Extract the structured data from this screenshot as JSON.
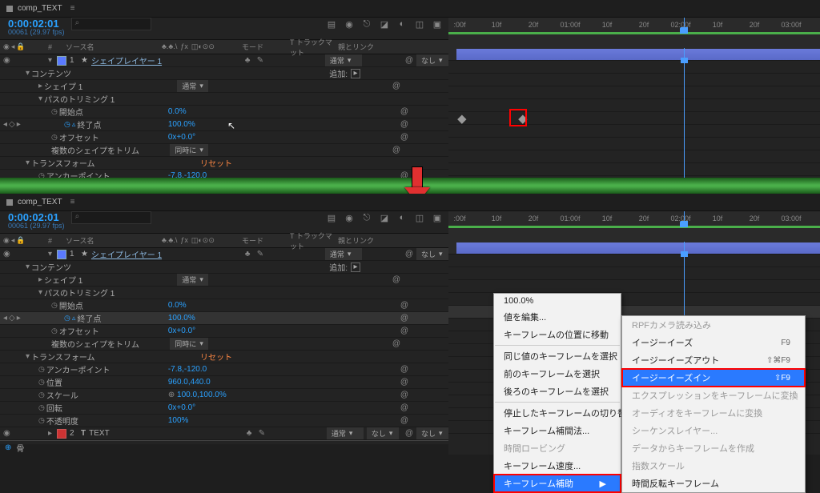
{
  "comp_tab": "comp_TEXT",
  "timecode": "0:00:02:01",
  "frameinfo": "00061 (29.97 fps)",
  "columns": {
    "num": "#",
    "source": "ソース名",
    "mode": "モード",
    "trackmatte": "T トラックマット",
    "parent": "親とリンク"
  },
  "layer1": {
    "idx": "1",
    "name": "シェイプレイヤー 1",
    "mode": "通常",
    "track_none": "なし",
    "contents": "コンテンツ",
    "add_label": "追加:",
    "shape1": "シェイプ 1",
    "shape1_mode": "通常",
    "trim_paths": "パスのトリミング 1",
    "start": "開始点",
    "start_val": "0.0%",
    "end": "終了点",
    "end_val": "100.0%",
    "end_val2": "100.0%",
    "offset": "オフセット",
    "offset_val": "0x+0.0°",
    "trim_multi": "複数のシェイプをトリム",
    "trim_multi_val": "同時に",
    "transform": "トランスフォーム",
    "transform_reset": "リセット",
    "anchor": "アンカーポイント",
    "anchor_val": "-7.8,-120.0",
    "position": "位置",
    "position_val": "960.0,440.0",
    "scale": "スケール",
    "scale_val": "100.0,100.0%",
    "rotation": "回転",
    "rotation_val": "0x+0.0°",
    "opacity": "不透明度",
    "opacity_val": "100%"
  },
  "layer2": {
    "idx": "2",
    "name": "TEXT",
    "mode": "通常",
    "none": "なし"
  },
  "ruler": {
    "t1": ":00f",
    "t2": "10f",
    "t3": "20f",
    "t4": "01:00f",
    "t5": "10f",
    "t6": "20f",
    "t7": "02:00f",
    "t7b": "02:00f",
    "t8": "10f",
    "t9": "20f",
    "t10": "03:00f"
  },
  "ctx1": {
    "m1": "100.0%",
    "m2": "値を編集...",
    "m3": "キーフレームの位置に移動",
    "m4": "同じ値のキーフレームを選択",
    "m5": "前のキーフレームを選択",
    "m6": "後ろのキーフレームを選択",
    "m7": "停止したキーフレームの切り替え",
    "m8": "キーフレーム補間法...",
    "m9": "時間ロービング",
    "m10": "キーフレーム速度...",
    "m11": "キーフレーム補助",
    "sub_arrow": "▶"
  },
  "ctx2": {
    "s1": "RPFカメラ読み込み",
    "s2": "イージーイーズ",
    "s2_key": "F9",
    "s3": "イージーイーズアウト",
    "s3_key": "⇧⌘F9",
    "s4": "イージーイーズイン",
    "s4_key": "⇧F9",
    "s5": "エクスプレッションをキーフレームに変換",
    "s6": "オーディオをキーフレームに変換",
    "s7": "シーケンスレイヤー...",
    "s8": "データからキーフレームを作成",
    "s9": "指数スケール",
    "s10": "時間反転キーフレーム"
  }
}
